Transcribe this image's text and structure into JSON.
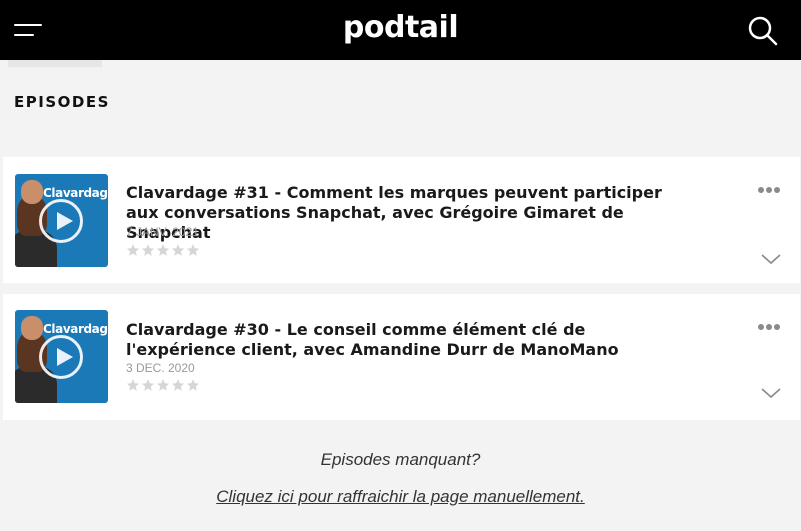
{
  "header": {
    "logo": "podtail",
    "menu_icon": "hamburger-icon",
    "search_icon": "search-icon",
    "background": "#000000"
  },
  "section": {
    "title": "EPISODES"
  },
  "episodes": [
    {
      "thumb_brand": "Clavardage",
      "title": "Clavardage #31 - Comment les marques peuvent participer aux conversations Snapchat, avec Grégoire Gimaret de Snapchat",
      "date": "7 JANV. 2021",
      "rating": 0,
      "rating_max": 5
    },
    {
      "thumb_brand": "Clavardage",
      "title": "Clavardage #30 - Le conseil comme élément clé de l'expérience client, avec Amandine Durr de ManoMano",
      "date": "3 DEC. 2020",
      "rating": 0,
      "rating_max": 5
    }
  ],
  "footer": {
    "missing_text": "Episodes manquant?",
    "refresh_link": "Cliquez ici pour raffraichir la page manuellement."
  },
  "colors": {
    "thumb_bg": "#1b79b8",
    "star_empty": "#d6d6d6",
    "date_text": "#9a9a9a"
  }
}
